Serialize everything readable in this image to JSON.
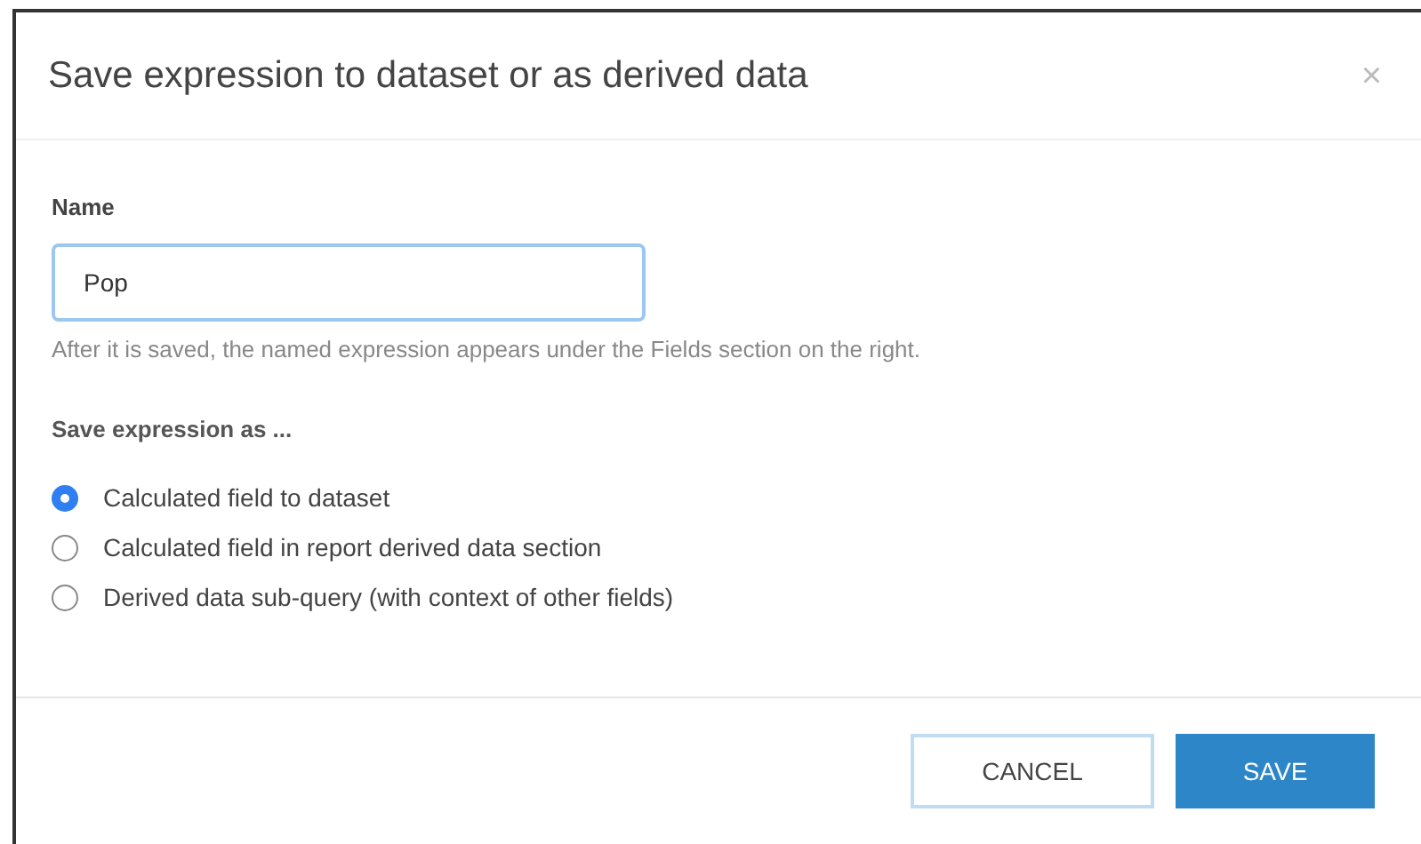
{
  "dialog": {
    "title": "Save expression to dataset or as derived data",
    "close": "×"
  },
  "name_field": {
    "label": "Name",
    "value": "Pop",
    "focused": true,
    "help": "After it is saved, the named expression appears under the Fields section on the right."
  },
  "save_as": {
    "label": "Save expression as ...",
    "options": [
      {
        "label": "Calculated field to dataset",
        "selected": true
      },
      {
        "label": "Calculated field in report derived data section",
        "selected": false
      },
      {
        "label": "Derived data sub-query (with context of other fields)",
        "selected": false
      }
    ]
  },
  "buttons": [
    {
      "label": "CANCEL",
      "kind": "secondary"
    },
    {
      "label": "SAVE",
      "kind": "primary"
    }
  ]
}
